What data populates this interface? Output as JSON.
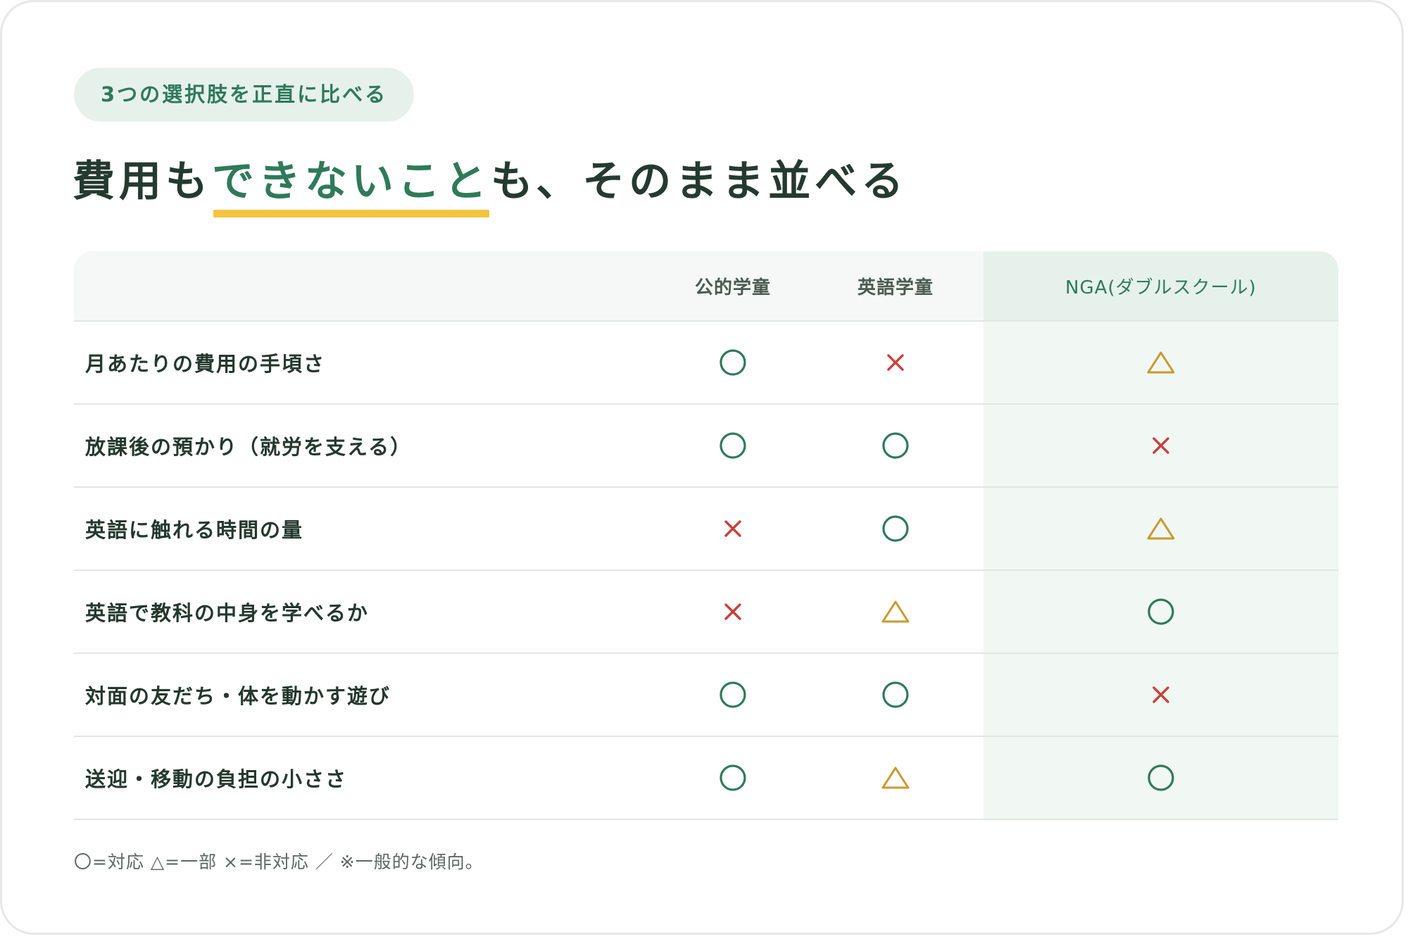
{
  "pill_label": "3つの選択肢を正直に比べる",
  "headline": {
    "before": "費用も",
    "highlight": "できないこと",
    "after": "も、そのまま並べる"
  },
  "table": {
    "columns": [
      "公的学童",
      "英語学童",
      "NGA(ダブルスクール)"
    ],
    "rows": [
      {
        "label": "月あたりの費用の手頃さ",
        "marks": [
          "circle",
          "cross",
          "triangle"
        ]
      },
      {
        "label": "放課後の預かり（就労を支える）",
        "marks": [
          "circle",
          "circle",
          "cross"
        ]
      },
      {
        "label": "英語に触れる時間の量",
        "marks": [
          "cross",
          "circle",
          "triangle"
        ]
      },
      {
        "label": "英語で教科の中身を学べるか",
        "marks": [
          "cross",
          "triangle",
          "circle"
        ]
      },
      {
        "label": "対面の友だち・体を動かす遊び",
        "marks": [
          "circle",
          "circle",
          "cross"
        ]
      },
      {
        "label": "送迎・移動の負担の小ささ",
        "marks": [
          "circle",
          "triangle",
          "circle"
        ]
      }
    ]
  },
  "legend": "〇=対応 △=一部 ×=非対応 ／ ※一般的な傾向。",
  "colors": {
    "circle": "#2f7a5a",
    "cross": "#c9403b",
    "triangle": "#c99a2c",
    "accent": "#2f7a5a",
    "underline": "#f4c43f"
  }
}
